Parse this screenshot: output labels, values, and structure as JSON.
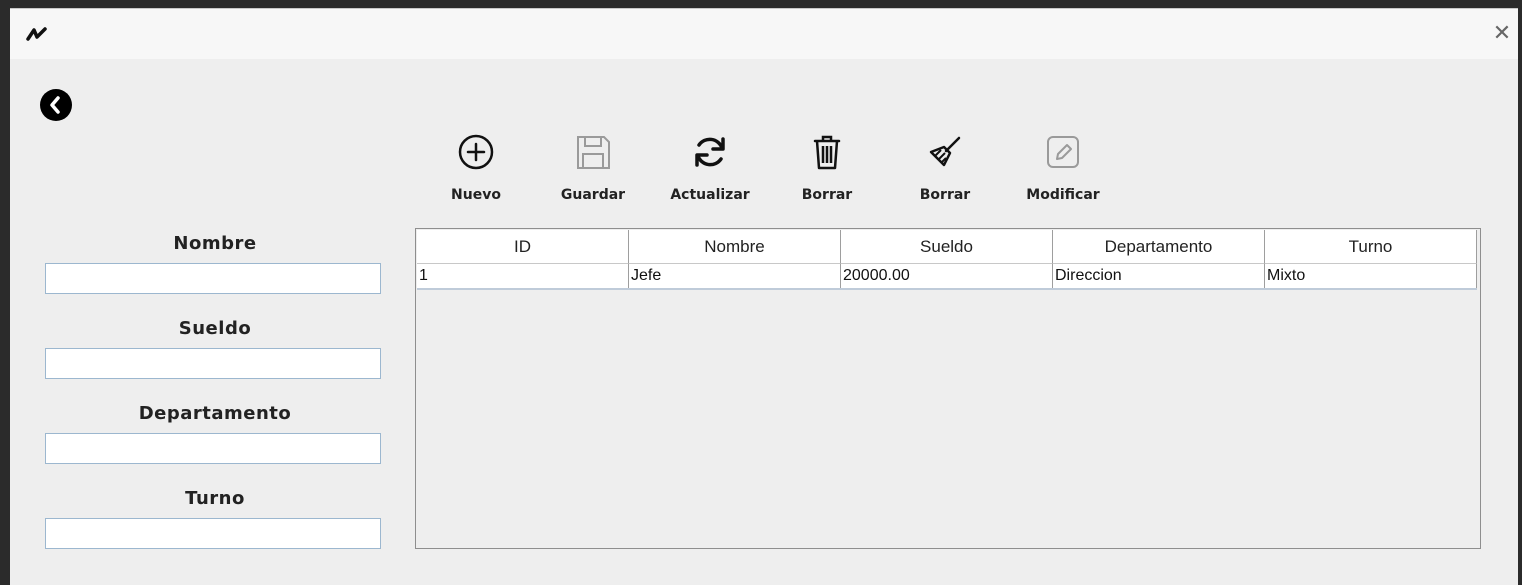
{
  "window": {
    "close_glyph": "✕"
  },
  "icons": {
    "app_logo": "app-logo-icon",
    "back": "chevron-left-circle-icon",
    "close": "close-icon"
  },
  "toolbar": {
    "nuevo": {
      "label": "Nuevo",
      "icon": "plus-circle-icon",
      "enabled": true
    },
    "guardar": {
      "label": "Guardar",
      "icon": "save-icon",
      "enabled": false
    },
    "actualizar": {
      "label": "Actualizar",
      "icon": "refresh-icon",
      "enabled": true
    },
    "borrar": {
      "label": "Borrar",
      "icon": "trash-icon",
      "enabled": true
    },
    "limpiar": {
      "label": "Borrar",
      "icon": "broom-icon",
      "enabled": true
    },
    "modificar": {
      "label": "Modificar",
      "icon": "edit-icon",
      "enabled": false
    }
  },
  "form": {
    "nombre": {
      "label": "Nombre",
      "value": ""
    },
    "sueldo": {
      "label": "Sueldo",
      "value": ""
    },
    "departamento": {
      "label": "Departamento",
      "value": ""
    },
    "turno": {
      "label": "Turno",
      "value": ""
    }
  },
  "table": {
    "columns": [
      "ID",
      "Nombre",
      "Sueldo",
      "Departamento",
      "Turno"
    ],
    "rows": [
      [
        "1",
        "Jefe",
        "20000.00",
        "Direccion",
        "Mixto"
      ]
    ]
  }
}
